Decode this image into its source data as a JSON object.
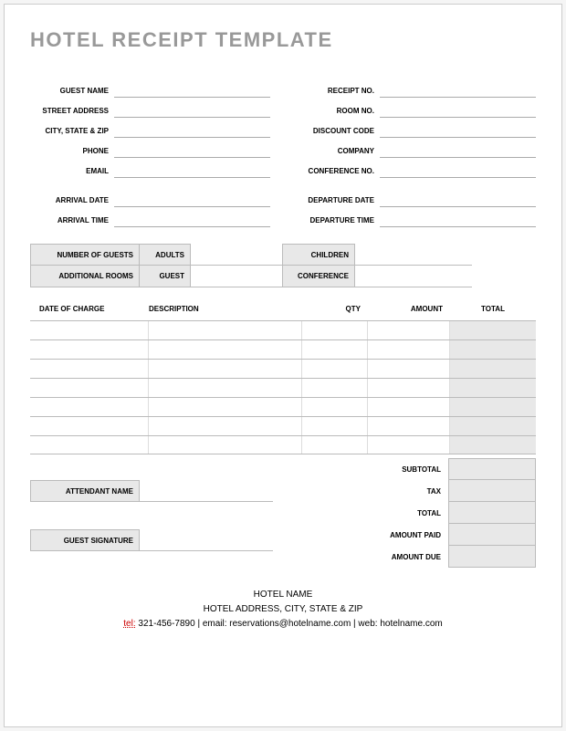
{
  "title": "HOTEL RECEIPT TEMPLATE",
  "guest": {
    "name_label": "GUEST NAME",
    "address_label": "STREET ADDRESS",
    "csz_label": "CITY, STATE & ZIP",
    "phone_label": "PHONE",
    "email_label": "EMAIL"
  },
  "receipt": {
    "no_label": "RECEIPT NO.",
    "room_label": "ROOM NO.",
    "discount_label": "DISCOUNT CODE",
    "company_label": "COMPANY",
    "conference_label": "CONFERENCE NO."
  },
  "arrival": {
    "date_label": "ARRIVAL DATE",
    "time_label": "ARRIVAL TIME"
  },
  "departure": {
    "date_label": "DEPARTURE DATE",
    "time_label": "DEPARTURE TIME"
  },
  "counts": {
    "guests_label": "NUMBER OF GUESTS",
    "adults_label": "ADULTS",
    "children_label": "CHILDREN",
    "rooms_label": "ADDITIONAL ROOMS",
    "guest_label": "GUEST",
    "conference_label": "CONFERENCE"
  },
  "charges_header": {
    "date": "DATE OF CHARGE",
    "desc": "DESCRIPTION",
    "qty": "QTY",
    "amount": "AMOUNT",
    "total": "TOTAL"
  },
  "summary": {
    "subtotal": "SUBTOTAL",
    "tax": "TAX",
    "total": "TOTAL",
    "paid": "AMOUNT PAID",
    "due": "AMOUNT DUE"
  },
  "sign": {
    "attendant": "ATTENDANT NAME",
    "guest_sig": "GUEST SIGNATURE"
  },
  "footer": {
    "hotel_name": "HOTEL NAME",
    "address": "HOTEL ADDRESS, CITY, STATE & ZIP",
    "tel_prefix": "tel:",
    "tel": " 321-456-7890",
    "sep1": "   |   email: ",
    "email": "reservations@hotelname.com",
    "sep2": "   |   web: ",
    "web": "hotelname.com"
  }
}
